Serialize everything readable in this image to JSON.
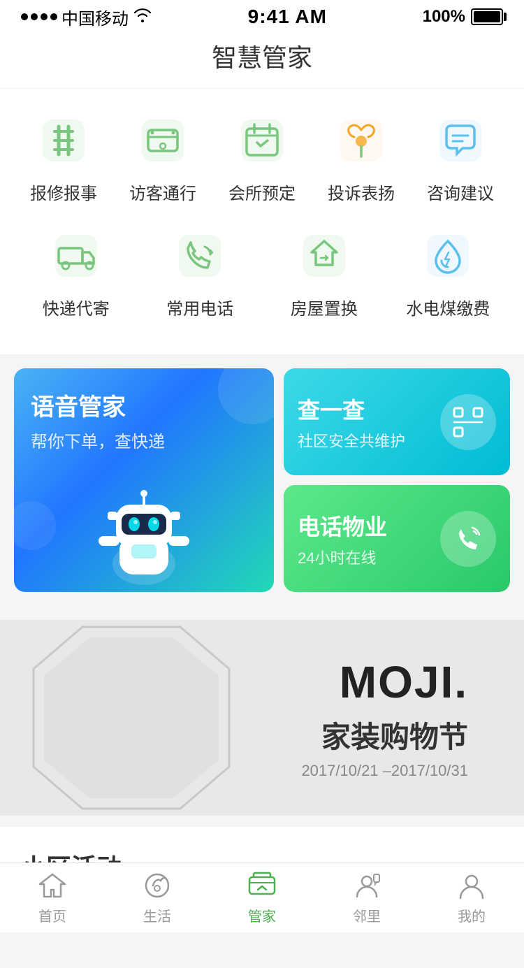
{
  "statusBar": {
    "carrier": "中国移动",
    "time": "9:41 AM",
    "battery": "100%"
  },
  "pageTitle": "智慧管家",
  "gridRow1": [
    {
      "id": "repair",
      "label": "报修报事",
      "icon": "wrench"
    },
    {
      "id": "visitor",
      "label": "访客通行",
      "icon": "ticket"
    },
    {
      "id": "club",
      "label": "会所预定",
      "icon": "calendar"
    },
    {
      "id": "complaint",
      "label": "投诉表扬",
      "icon": "flower"
    },
    {
      "id": "consult",
      "label": "咨询建议",
      "icon": "chat"
    }
  ],
  "gridRow2": [
    {
      "id": "express",
      "label": "快递代寄",
      "icon": "truck"
    },
    {
      "id": "phone",
      "label": "常用电话",
      "icon": "phone"
    },
    {
      "id": "house",
      "label": "房屋置换",
      "icon": "house"
    },
    {
      "id": "utility",
      "label": "水电煤缴费",
      "icon": "drop"
    }
  ],
  "featureCards": {
    "left": {
      "title": "语音管家",
      "subtitle": "帮你下单，查快递"
    },
    "rightTop": {
      "title": "查一查",
      "subtitle": "社区安全共维护"
    },
    "rightBottom": {
      "title": "电话物业",
      "subtitle": "24小时在线"
    }
  },
  "banner": {
    "brand": "MOJI.",
    "title": "家装购物节",
    "date": "2017/10/21 –2017/10/31"
  },
  "activity": {
    "title": "小区活动",
    "arrow": "›"
  },
  "bottomNav": [
    {
      "id": "home",
      "label": "首页",
      "icon": "home",
      "active": false
    },
    {
      "id": "life",
      "label": "生活",
      "icon": "life",
      "active": false
    },
    {
      "id": "manager",
      "label": "管家",
      "icon": "manager",
      "active": true
    },
    {
      "id": "neighbor",
      "label": "邻里",
      "icon": "neighbor",
      "active": false
    },
    {
      "id": "mine",
      "label": "我的",
      "icon": "mine",
      "active": false
    }
  ]
}
